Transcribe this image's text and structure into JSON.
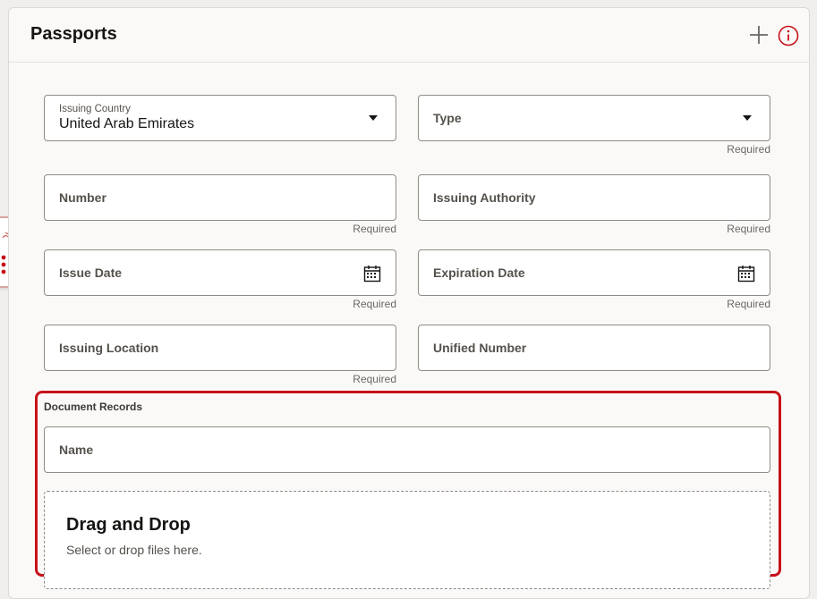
{
  "panel": {
    "title": "Passports",
    "add_icon": "plus-icon",
    "info_icon": "info-icon",
    "accent": "#c7111a"
  },
  "fields": {
    "issuing_country": {
      "label": "Issuing Country",
      "value": "United Arab Emirates"
    },
    "type": {
      "label": "Type",
      "hint": "Required"
    },
    "number": {
      "label": "Number",
      "hint": "Required"
    },
    "issuing_authority": {
      "label": "Issuing Authority",
      "hint": "Required"
    },
    "issue_date": {
      "label": "Issue Date",
      "hint": "Required"
    },
    "expiration_date": {
      "label": "Expiration Date",
      "hint": "Required"
    },
    "issuing_location": {
      "label": "Issuing Location",
      "hint": "Required"
    },
    "unified_number": {
      "label": "Unified Number"
    }
  },
  "document_records": {
    "label": "Document Records",
    "name_field": {
      "label": "Name"
    },
    "dropzone": {
      "title": "Drag and Drop",
      "subtitle": "Select or drop files here."
    }
  },
  "side_tab": {
    "icons": [
      "handwave-icon",
      "grid-dots-icon"
    ]
  }
}
